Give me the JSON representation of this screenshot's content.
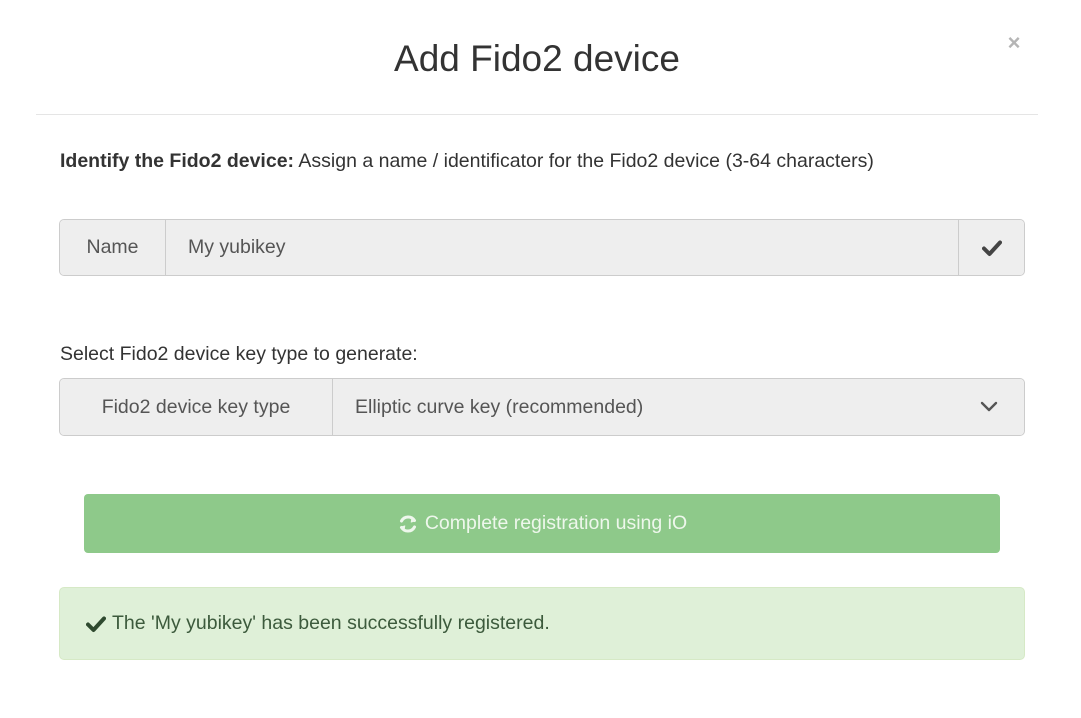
{
  "dialog": {
    "title": "Add Fido2 device",
    "close_label": "×"
  },
  "intro": {
    "bold": "Identify the Fido2 device:",
    "text": " Assign a name / identificator for the Fido2 device (3-64 characters)"
  },
  "name_field": {
    "addon_label": "Name",
    "value": "My yubikey",
    "status_icon": "check-icon"
  },
  "key_type": {
    "prompt": "Select Fido2 device key type to generate:",
    "addon_label": "Fido2 device key type",
    "selected": "Elliptic curve key (recommended)",
    "icon": "chevron-down-icon"
  },
  "register_button": {
    "icon": "refresh-icon",
    "label": "Complete registration using iO",
    "color": "#8ec98a"
  },
  "alert": {
    "icon": "check-icon",
    "message": "The 'My yubikey' has been successfully registered.",
    "color": "#dff0d8"
  }
}
